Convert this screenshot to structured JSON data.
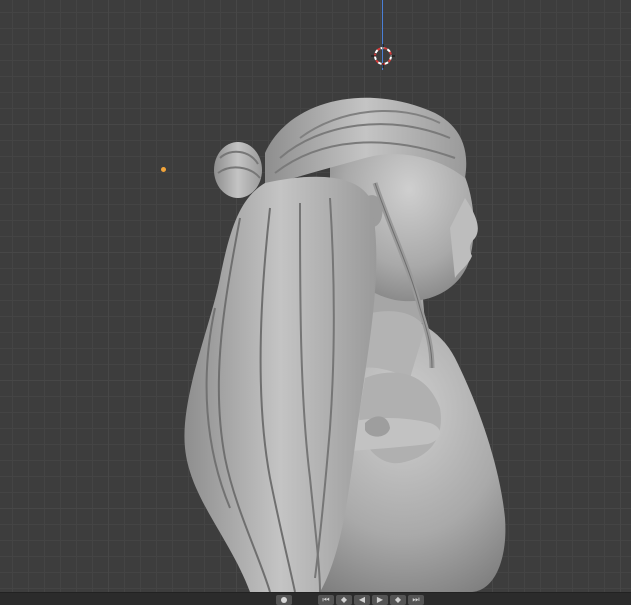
{
  "viewport": {
    "name": "3D viewport",
    "object": "character-sculpt",
    "colors": {
      "background": "#3d3d3d",
      "grid": "#474747",
      "z_axis": "#4a7fd6",
      "light": "#f2a43a"
    }
  },
  "timeline": {
    "controls": [
      {
        "name": "jump-start-icon",
        "glyph": "⏮"
      },
      {
        "name": "jump-prev-keyframe-icon",
        "glyph": "◆"
      },
      {
        "name": "play-reverse-icon",
        "glyph": "◀"
      },
      {
        "name": "play-icon",
        "glyph": "▶"
      },
      {
        "name": "jump-next-keyframe-icon",
        "glyph": "◆"
      },
      {
        "name": "jump-end-icon",
        "glyph": "⏭"
      }
    ]
  }
}
